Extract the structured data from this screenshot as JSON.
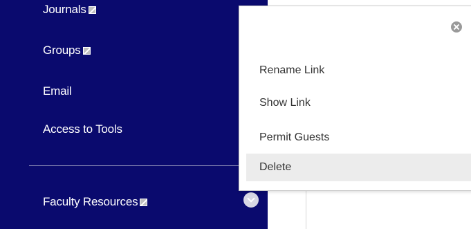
{
  "sidebar": {
    "items": [
      {
        "label": "Journals",
        "hidden_icon": "hidden-link-icon"
      },
      {
        "label": "Groups",
        "hidden_icon": "hidden-link-icon"
      },
      {
        "label": "Email"
      },
      {
        "label": "Access to Tools"
      },
      {
        "label": "Faculty Resources",
        "hidden_icon": "hidden-link-icon"
      }
    ],
    "background": "#0a0a6e"
  },
  "context_menu": {
    "close_icon": "close-icon",
    "items": [
      {
        "label": "Rename Link"
      },
      {
        "label": "Show Link"
      },
      {
        "label": "Permit Guests"
      },
      {
        "label": "Delete",
        "highlighted": true
      }
    ]
  },
  "colors": {
    "menu_highlight": "#ececec",
    "menu_text": "#333333"
  }
}
